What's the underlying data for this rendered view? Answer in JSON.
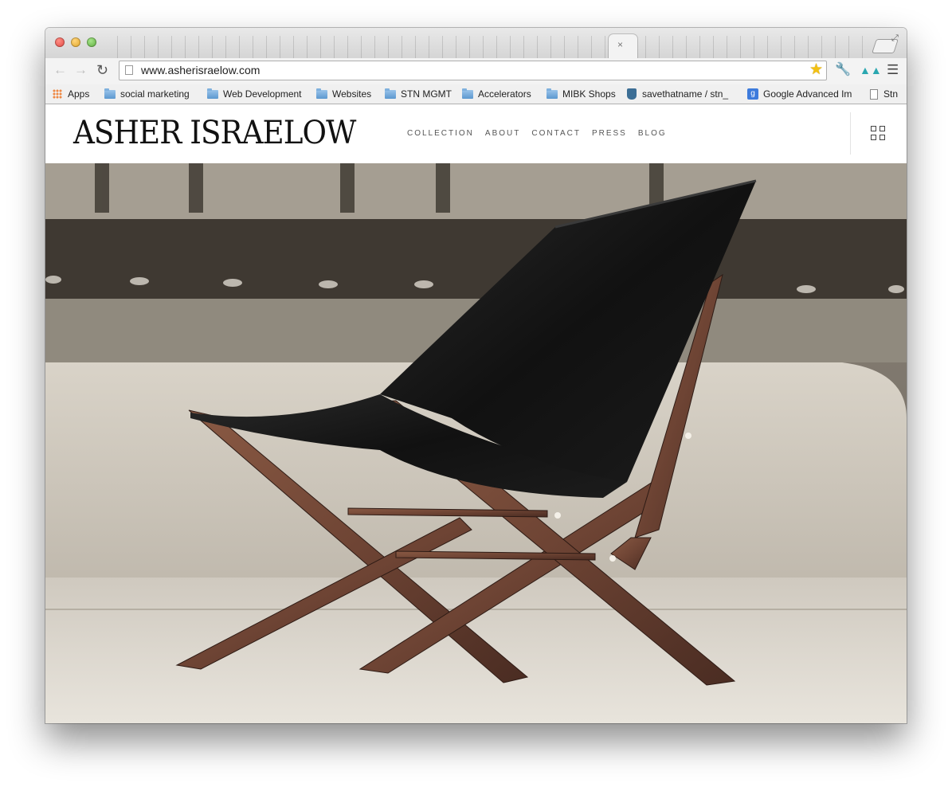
{
  "browser": {
    "url": "www.asherisraelow.com",
    "tab_close": "×",
    "icons": {
      "back": "back-arrow-icon",
      "forward": "forward-arrow-icon",
      "reload": "reload-icon",
      "bookmark_star": "star-icon",
      "wrench": "wrench-icon",
      "extension": "extension-icon",
      "menu": "hamburger-menu-icon"
    },
    "accent_color": "#f3c112"
  },
  "bookmarks": [
    {
      "label": "Apps",
      "icon": "apps-icon"
    },
    {
      "label": "social marketing",
      "icon": "folder-icon"
    },
    {
      "label": "Web Development",
      "icon": "folder-icon"
    },
    {
      "label": "Websites",
      "icon": "folder-icon"
    },
    {
      "label": "STN MGMT",
      "icon": "folder-icon"
    },
    {
      "label": "Accelerators",
      "icon": "folder-icon"
    },
    {
      "label": "MIBK Shops",
      "icon": "folder-icon"
    },
    {
      "label": "savethatname / stn_",
      "icon": "bucket-icon"
    },
    {
      "label": "Google Advanced Im",
      "icon": "google-icon"
    },
    {
      "label": "Stn",
      "icon": "document-icon"
    }
  ],
  "site": {
    "logo": "ASHER ISRAELOW",
    "nav": [
      "COLLECTION",
      "ABOUT",
      "CONTACT",
      "PRESS",
      "BLOG"
    ],
    "grid_icon": "grid-menu-icon"
  },
  "hero": {
    "image": "walnut-frame-black-leather-lounge-chair-photo"
  }
}
